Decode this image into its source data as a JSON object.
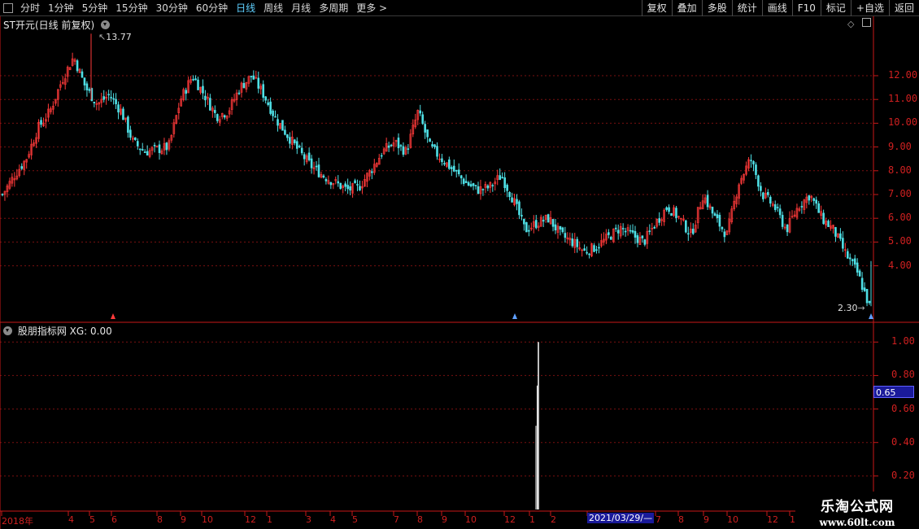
{
  "toolbar": {
    "tabs": [
      "分时",
      "1分钟",
      "5分钟",
      "15分钟",
      "30分钟",
      "60分钟",
      "日线",
      "周线",
      "月线",
      "多周期",
      "更多 >"
    ],
    "active_tab": "日线",
    "right_buttons": [
      "复权",
      "叠加",
      "多股",
      "统计",
      "画线",
      "F10",
      "标记",
      "+自选",
      "返回"
    ]
  },
  "main_panel": {
    "title": "ST开元(日线 前复权)",
    "high_marker": "13.77",
    "low_marker": "2.30",
    "y_ticks": [
      "12.00",
      "11.00",
      "10.00",
      "9.00",
      "8.00",
      "7.00",
      "6.00",
      "5.00",
      "4.00"
    ]
  },
  "sub_panel": {
    "title": "股朋指标网 XG: 0.00",
    "y_ticks": [
      "1.00",
      "0.80",
      "0.60",
      "0.40",
      "0.20"
    ],
    "cursor_value": "0.65"
  },
  "x_axis": {
    "labels": [
      "2018年",
      "4",
      "5",
      "6",
      "8",
      "9",
      "10",
      "12",
      "1",
      "3",
      "4",
      "5",
      "7",
      "8",
      "9",
      "10",
      "12",
      "1",
      "2",
      "2021/03/29/—",
      "7",
      "8",
      "9",
      "10",
      "12",
      "1"
    ]
  },
  "watermark": {
    "line1": "乐淘公式网",
    "line2": "www.60lt.com"
  },
  "colors": {
    "up": "#ff3a3a",
    "down": "#4fe0e6",
    "axis_red": "#c81818",
    "active_tab": "#5fd0ff",
    "cursor_box": "#1a1a9a"
  },
  "chart_data": [
    {
      "type": "candlestick",
      "title": "ST开元(日线 前复权)",
      "ylim": [
        2.3,
        13.77
      ],
      "yticks": [
        4,
        5,
        6,
        7,
        8,
        9,
        10,
        11,
        12
      ],
      "close_path": [
        7.0,
        7.8,
        8.5,
        9.8,
        10.5,
        11.8,
        12.8,
        11.5,
        10.8,
        11.2,
        10.5,
        9.2,
        8.8,
        8.9,
        9.0,
        11.0,
        12.0,
        11.2,
        10.3,
        10.5,
        11.5,
        12.0,
        11.2,
        10.2,
        9.5,
        8.8,
        8.2,
        7.8,
        7.5,
        7.2,
        7.3,
        8.0,
        8.8,
        9.2,
        8.8,
        10.5,
        9.0,
        8.5,
        8.0,
        7.5,
        7.2,
        7.3,
        7.8,
        6.8,
        5.5,
        5.8,
        6.0,
        5.3,
        5.0,
        4.6,
        4.8,
        5.2,
        5.6,
        5.3,
        5.0,
        5.8,
        6.5,
        6.0,
        5.3,
        7.0,
        6.0,
        5.3,
        7.5,
        8.5,
        7.0,
        6.5,
        5.5,
        6.5,
        7.0,
        6.0,
        5.5,
        4.5,
        3.7,
        2.3
      ],
      "high": 13.77,
      "low": 2.3
    },
    {
      "type": "bar",
      "title": "股朋指标网 XG: 0.00",
      "ylim": [
        0,
        1.05
      ],
      "yticks": [
        0.2,
        0.4,
        0.6,
        0.8,
        1.0
      ],
      "signal_value": 1.0,
      "signal_date": "2021/03/29"
    }
  ]
}
